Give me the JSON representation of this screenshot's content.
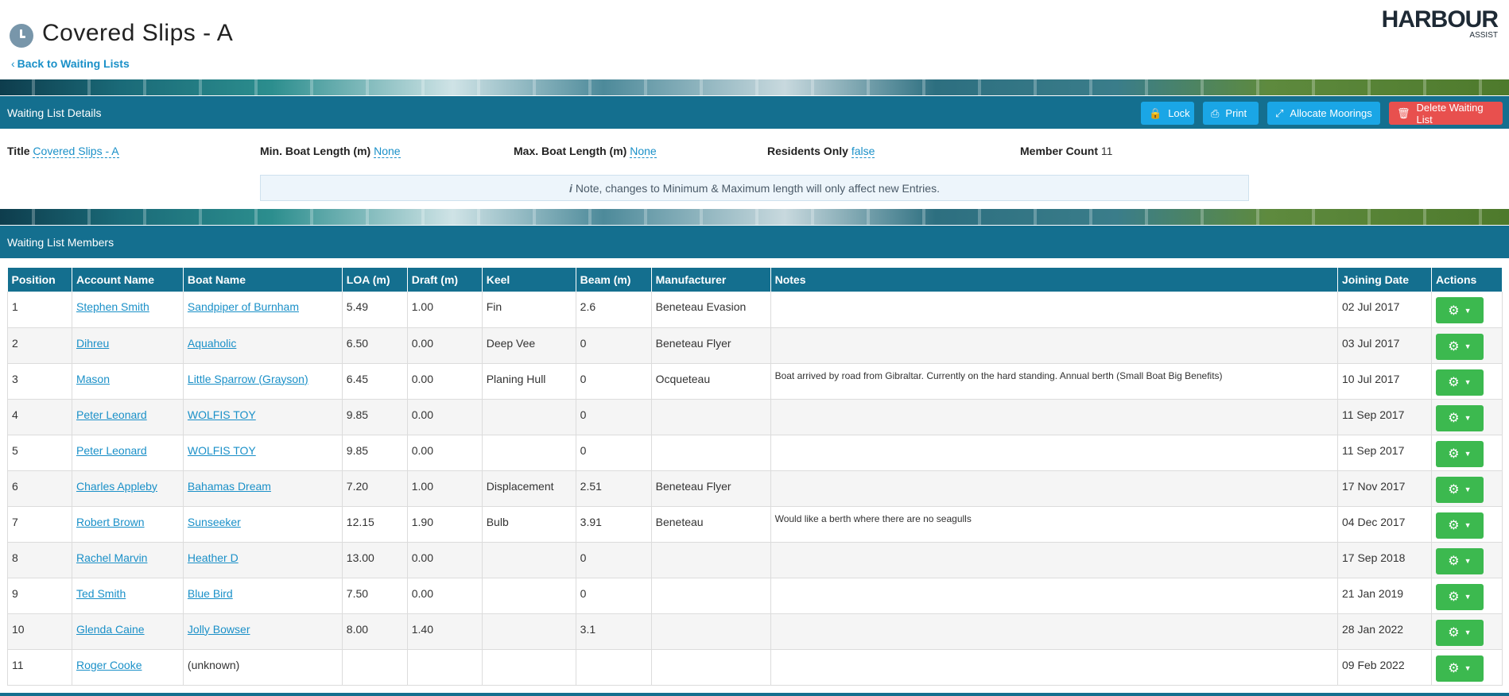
{
  "header": {
    "title": "Covered Slips - A",
    "back_link": "Back to Waiting Lists",
    "logo_main": "HARBOUR",
    "logo_sub": "ASSIST"
  },
  "details_bar": {
    "title": "Waiting List Details",
    "buttons": {
      "lock": "Lock",
      "print": "Print",
      "allocate": "Allocate Moorings",
      "delete": "Delete Waiting List"
    }
  },
  "details": {
    "title_label": "Title",
    "title_value": "Covered Slips - A",
    "min_label": "Min. Boat Length (m)",
    "min_value": "None",
    "max_label": "Max. Boat Length (m)",
    "max_value": "None",
    "residents_label": "Residents Only",
    "residents_value": "false",
    "count_label": "Member Count",
    "count_value": "11",
    "note": "Note, changes to Minimum & Maximum length will only affect new Entries."
  },
  "members_bar": {
    "title": "Waiting List Members"
  },
  "table": {
    "headers": {
      "position": "Position",
      "account": "Account Name",
      "boat": "Boat Name",
      "loa": "LOA (m)",
      "draft": "Draft (m)",
      "keel": "Keel",
      "beam": "Beam (m)",
      "manufacturer": "Manufacturer",
      "notes": "Notes",
      "joining": "Joining Date",
      "actions": "Actions"
    },
    "rows": [
      {
        "position": "1",
        "account": "Stephen Smith",
        "boat": "Sandpiper of Burnham",
        "loa": "5.49",
        "draft": "1.00",
        "keel": "Fin",
        "beam": "2.6",
        "manufacturer": "Beneteau Evasion",
        "notes": "",
        "joining": "02 Jul 2017"
      },
      {
        "position": "2",
        "account": "Dihreu",
        "boat": "Aquaholic",
        "loa": "6.50",
        "draft": "0.00",
        "keel": "Deep Vee",
        "beam": "0",
        "manufacturer": "Beneteau Flyer",
        "notes": "",
        "joining": "03 Jul 2017"
      },
      {
        "position": "3",
        "account": "Mason",
        "boat": "Little Sparrow (Grayson)",
        "loa": "6.45",
        "draft": "0.00",
        "keel": "Planing Hull",
        "beam": "0",
        "manufacturer": "Ocqueteau",
        "notes": "Boat arrived by road from Gibraltar. Currently on the hard standing. Annual berth (Small Boat Big Benefits)",
        "joining": "10 Jul 2017"
      },
      {
        "position": "4",
        "account": "Peter Leonard",
        "boat": "WOLFIS TOY",
        "loa": "9.85",
        "draft": "0.00",
        "keel": "",
        "beam": "0",
        "manufacturer": "",
        "notes": "",
        "joining": "11 Sep 2017"
      },
      {
        "position": "5",
        "account": "Peter Leonard",
        "boat": "WOLFIS TOY",
        "loa": "9.85",
        "draft": "0.00",
        "keel": "",
        "beam": "0",
        "manufacturer": "",
        "notes": "",
        "joining": "11 Sep 2017"
      },
      {
        "position": "6",
        "account": "Charles Appleby",
        "boat": "Bahamas Dream",
        "loa": "7.20",
        "draft": "1.00",
        "keel": "Displacement",
        "beam": "2.51",
        "manufacturer": "Beneteau Flyer",
        "notes": "",
        "joining": "17 Nov 2017"
      },
      {
        "position": "7",
        "account": "Robert Brown",
        "boat": "Sunseeker",
        "loa": "12.15",
        "draft": "1.90",
        "keel": "Bulb",
        "beam": "3.91",
        "manufacturer": "Beneteau",
        "notes": "Would like a berth where there are no seagulls",
        "joining": "04 Dec 2017"
      },
      {
        "position": "8",
        "account": "Rachel Marvin",
        "boat": "Heather D",
        "loa": "13.00",
        "draft": "0.00",
        "keel": "",
        "beam": "0",
        "manufacturer": "",
        "notes": "",
        "joining": "17 Sep 2018"
      },
      {
        "position": "9",
        "account": "Ted Smith",
        "boat": "Blue Bird",
        "loa": "7.50",
        "draft": "0.00",
        "keel": "",
        "beam": "0",
        "manufacturer": "",
        "notes": "",
        "joining": "21 Jan 2019"
      },
      {
        "position": "10",
        "account": "Glenda Caine",
        "boat": "Jolly Bowser",
        "loa": "8.00",
        "draft": "1.40",
        "keel": "",
        "beam": "3.1",
        "manufacturer": "",
        "notes": "",
        "joining": "28 Jan 2022"
      },
      {
        "position": "11",
        "account": "Roger Cooke",
        "boat": "(unknown)",
        "boat_linked": false,
        "loa": "",
        "draft": "",
        "keel": "",
        "beam": "",
        "manufacturer": "",
        "notes": "",
        "joining": "09 Feb 2022"
      }
    ]
  },
  "colors": {
    "primary_bar": "#146f8f",
    "link": "#1a90c8",
    "button_blue": "#1aa6e6",
    "button_red": "#e8504e",
    "button_green": "#3cb94f"
  },
  "icons": {
    "title_icon": "clock-icon",
    "lock": "lock-icon",
    "print": "print-icon",
    "allocate": "arrows-collapse-icon",
    "delete": "trash-icon",
    "actions": "gear-icon"
  }
}
